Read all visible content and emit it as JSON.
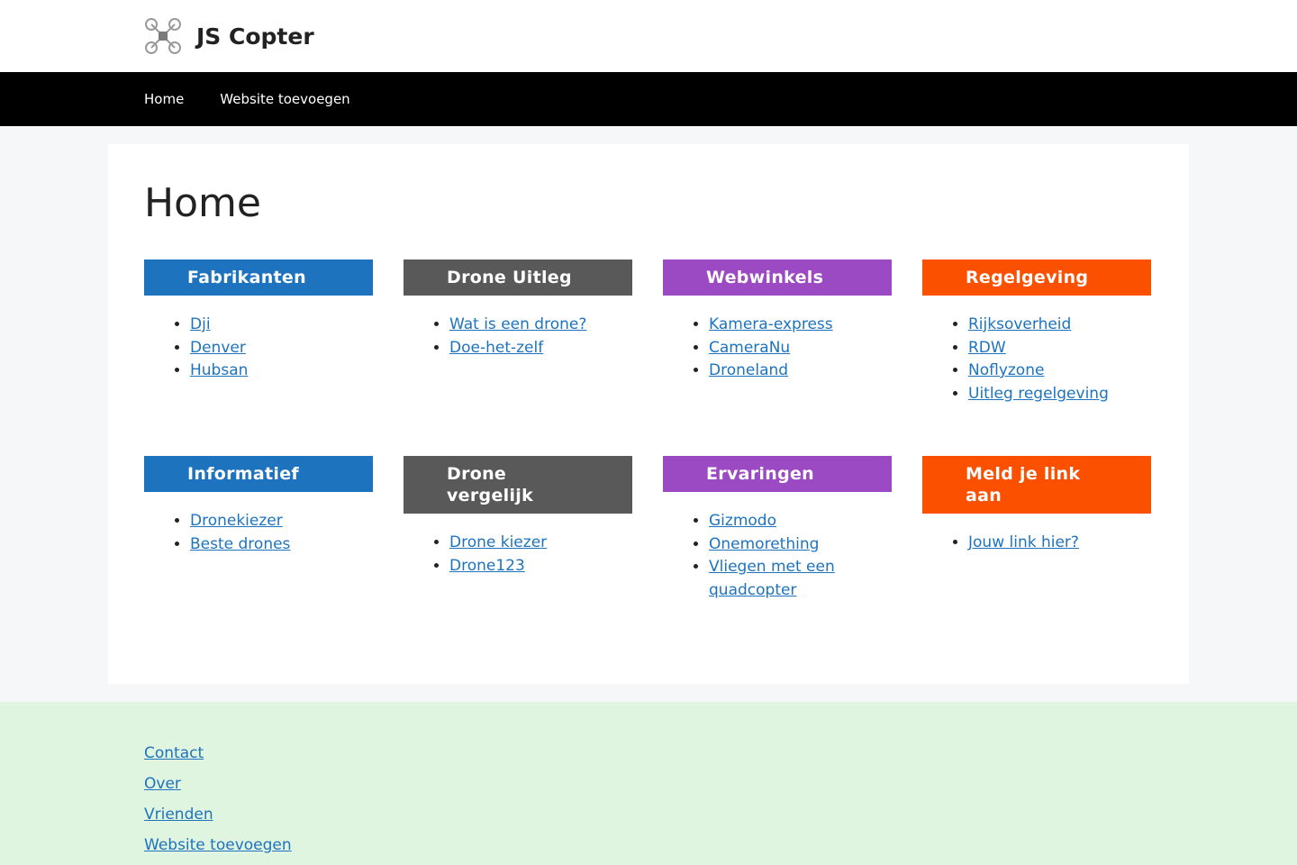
{
  "site": {
    "title": "JS Copter"
  },
  "nav": {
    "items": [
      {
        "label": "Home"
      },
      {
        "label": "Website toevoegen"
      }
    ]
  },
  "page": {
    "title": "Home"
  },
  "blocks": [
    {
      "title": "Fabrikanten",
      "color": "#1e73be",
      "links": [
        "Dji",
        "Denver",
        "Hubsan"
      ]
    },
    {
      "title": "Drone Uitleg",
      "color": "#595959",
      "links": [
        "Wat is een drone?",
        "Doe-het-zelf"
      ]
    },
    {
      "title": "Webwinkels",
      "color": "#9b4ac3",
      "links": [
        "Kamera-express",
        "CameraNu",
        "Droneland"
      ]
    },
    {
      "title": "Regelgeving",
      "color": "#fa5000",
      "links": [
        "Rijksoverheid",
        "RDW",
        "Noflyzone",
        "Uitleg regelgeving"
      ]
    },
    {
      "title": "Informatief",
      "color": "#1e73be",
      "links": [
        "Dronekiezer",
        "Beste drones"
      ]
    },
    {
      "title": "Drone vergelijk",
      "color": "#595959",
      "links": [
        "Drone kiezer",
        "Drone123"
      ]
    },
    {
      "title": "Ervaringen",
      "color": "#9b4ac3",
      "links": [
        "Gizmodo",
        "Onemorething",
        "Vliegen met een quadcopter"
      ]
    },
    {
      "title": "Meld je link aan",
      "color": "#fa5000",
      "links": [
        "Jouw link hier?"
      ]
    }
  ],
  "footer": {
    "links": [
      {
        "label": "Contact"
      },
      {
        "label": "Over"
      },
      {
        "label": "Vrienden"
      },
      {
        "label": "Website toevoegen"
      }
    ]
  },
  "icons": {
    "logo": "drone-icon"
  }
}
